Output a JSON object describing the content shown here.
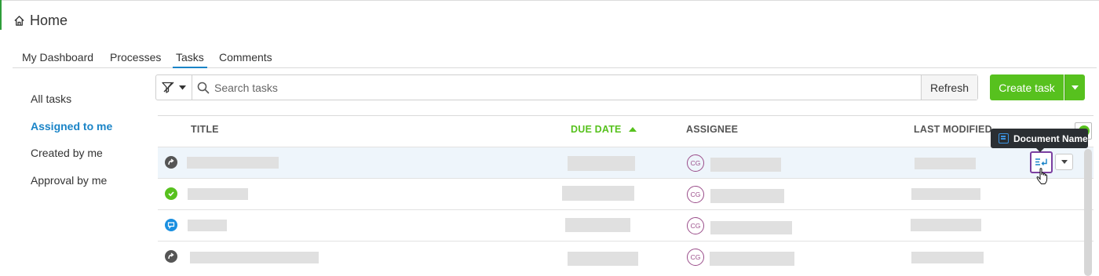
{
  "header": {
    "title": "Home",
    "home_icon": "home-icon"
  },
  "tabs": [
    {
      "label": "My Dashboard",
      "active": false
    },
    {
      "label": "Processes",
      "active": false
    },
    {
      "label": "Tasks",
      "active": true
    },
    {
      "label": "Comments",
      "active": false
    }
  ],
  "sidebar": {
    "items": [
      {
        "label": "All tasks",
        "active": false
      },
      {
        "label": "Assigned to me",
        "active": true
      },
      {
        "label": "Created by me",
        "active": false
      },
      {
        "label": "Approval by me",
        "active": false
      }
    ]
  },
  "toolbar": {
    "filter_icon": "filter-icon",
    "search_placeholder": "Search tasks",
    "refresh_label": "Refresh",
    "create_label": "Create task"
  },
  "table": {
    "columns": [
      {
        "label": "TITLE",
        "sorted": false
      },
      {
        "label": "DUE DATE",
        "sorted": true,
        "sort_direction": "ascending"
      },
      {
        "label": "ASSIGNEE",
        "sorted": false
      },
      {
        "label": "LAST MODIFIED",
        "sorted": false
      }
    ],
    "rows": [
      {
        "status": "in-progress",
        "assignee_initials": "CG",
        "highlighted": true
      },
      {
        "status": "completed",
        "assignee_initials": "CG",
        "highlighted": false
      },
      {
        "status": "commented",
        "assignee_initials": "CG",
        "highlighted": false
      },
      {
        "status": "in-progress",
        "assignee_initials": "CG",
        "highlighted": false
      }
    ]
  },
  "tooltip": {
    "label": "Document Name",
    "icon": "document-icon"
  },
  "colors": {
    "accent_blue": "#1a84c7",
    "brand_green": "#57c11e",
    "focus_purple": "#7b3fa0",
    "tooltip_bg": "#2b2f33",
    "avatar_purple": "#9a4d8a"
  }
}
